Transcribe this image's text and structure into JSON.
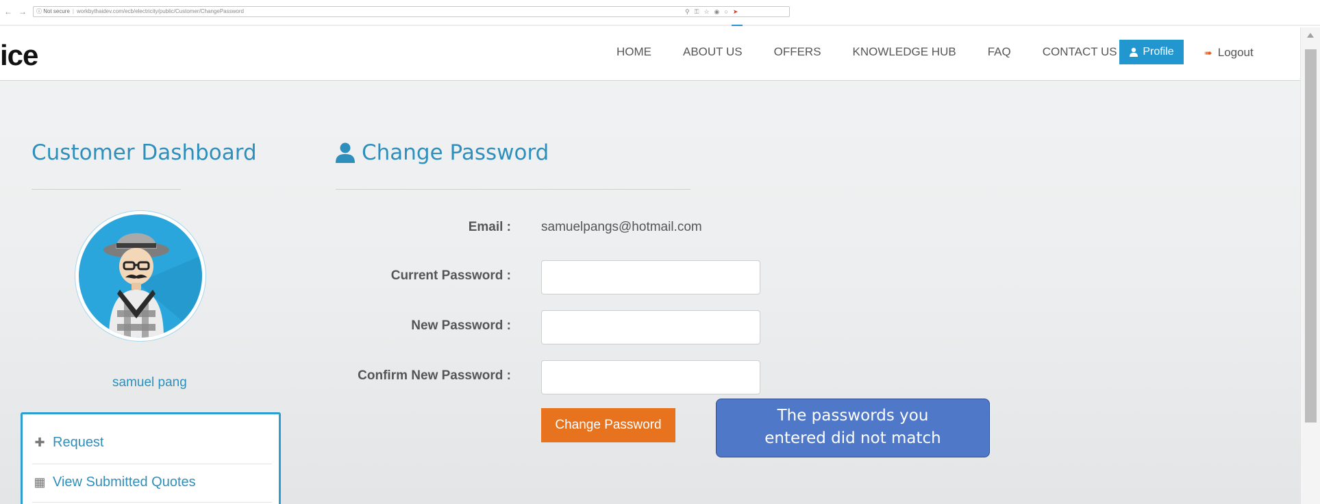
{
  "browser": {
    "nav_back": "←",
    "nav_forward": "→",
    "nav_reload": "C",
    "security_label": "ⓘ Not secure",
    "url": "workbythaidev.com/ecb/electricity/public/Customer/ChangePassword"
  },
  "header": {
    "logo_fragment": "ice",
    "nav": [
      "HOME",
      "ABOUT US",
      "OFFERS",
      "KNOWLEDGE HUB",
      "FAQ",
      "CONTACT US"
    ],
    "profile_label": "Profile",
    "logout_label": "Logout"
  },
  "sidebar": {
    "title": "Customer Dashboard",
    "username": "samuel pang",
    "menu": [
      {
        "label": "Request",
        "icon": "plus-icon"
      },
      {
        "label": "View Submitted Quotes",
        "icon": "table-icon"
      }
    ]
  },
  "form": {
    "title": "Change Password",
    "email_label": "Email :",
    "email_value": "samuelpangs@hotmail.com",
    "current_password_label": "Current Password :",
    "new_password_label": "New Password :",
    "confirm_password_label": "Confirm New Password :",
    "current_password_value": "",
    "new_password_value": "",
    "confirm_password_value": "",
    "submit_label": "Change Password"
  },
  "error_message": {
    "line1": "The passwords you",
    "line2": "entered did not match"
  },
  "colors": {
    "accent_blue": "#2e8fbc",
    "profile_button": "#2196cf",
    "submit_button": "#e8731f",
    "error_callout": "#4f78c8"
  }
}
